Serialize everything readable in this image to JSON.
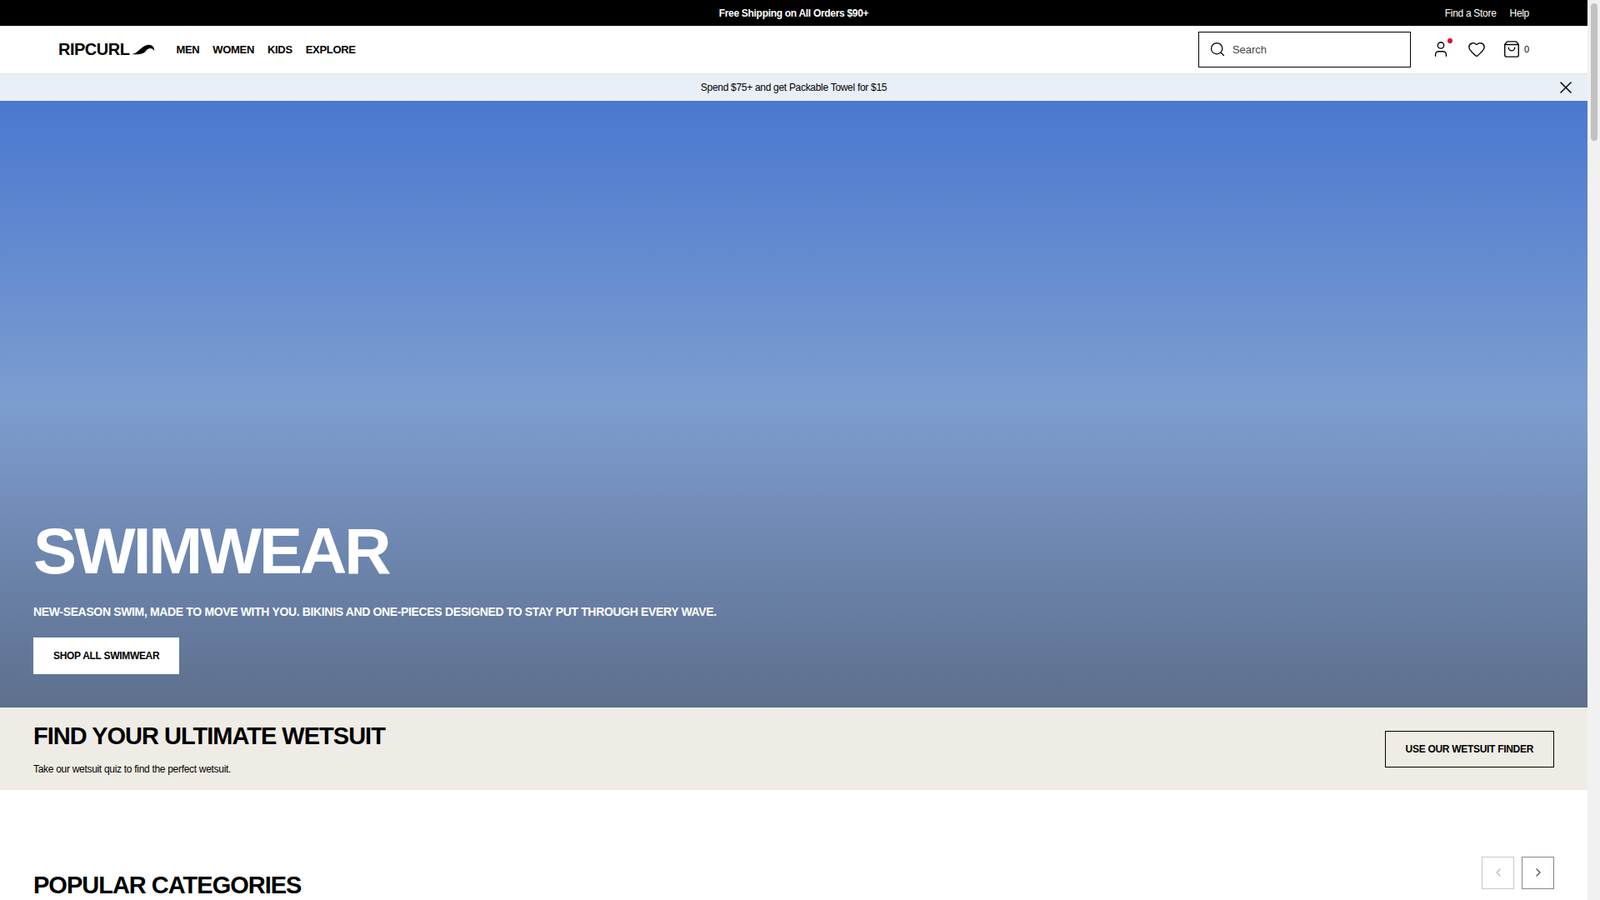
{
  "top_bar": {
    "message": "Free Shipping on All Orders $90+",
    "links": [
      "Find a Store",
      "Help"
    ]
  },
  "header": {
    "logo": "RIPCURL",
    "nav": [
      "MEN",
      "WOMEN",
      "KIDS",
      "EXPLORE"
    ],
    "search": {
      "placeholder": "Search"
    },
    "cart_count": "0",
    "account_notification": true
  },
  "promo": {
    "message": "Spend $75+ and get Packable Towel for $15"
  },
  "hero": {
    "title": "SWIMWEAR",
    "subtitle": "NEW-SEASON SWIM, MADE TO MOVE WITH YOU. BIKINIS AND ONE-PIECES DESIGNED TO STAY PUT THROUGH EVERY WAVE.",
    "button": "SHOP ALL SWIMWEAR"
  },
  "wetsuit_finder": {
    "title": "FIND YOUR ULTIMATE WETSUIT",
    "text": "Take our wetsuit quiz to find the perfect wetsuit.",
    "button": "USE OUR WETSUIT FINDER"
  },
  "popular_categories": {
    "title": "POPULAR CATEGORIES",
    "prev_disabled": true
  }
}
